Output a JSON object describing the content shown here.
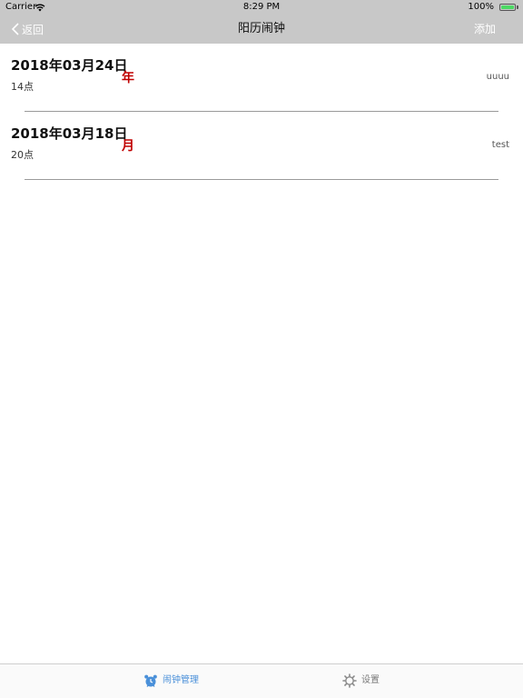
{
  "status_bar": {
    "carrier": "Carrier",
    "time": "8:29 PM",
    "battery": "100%"
  },
  "nav": {
    "back_label": "返回",
    "title": "阳历闹钟",
    "add_label": "添加"
  },
  "alarms": [
    {
      "date": "2018年03月24日",
      "hour": "14点",
      "repeat": "年",
      "note": "uuuu"
    },
    {
      "date": "2018年03月18日",
      "hour": "20点",
      "repeat": "月",
      "note": "test"
    }
  ],
  "tabs": [
    {
      "label": "闹钟管理",
      "icon": "alarm-clock-icon",
      "active": true
    },
    {
      "label": "设置",
      "icon": "gear-icon",
      "active": false
    }
  ],
  "colors": {
    "nav_background": "#c8c8c8",
    "accent_red": "#c00000",
    "active_tab": "#4a90d9"
  }
}
